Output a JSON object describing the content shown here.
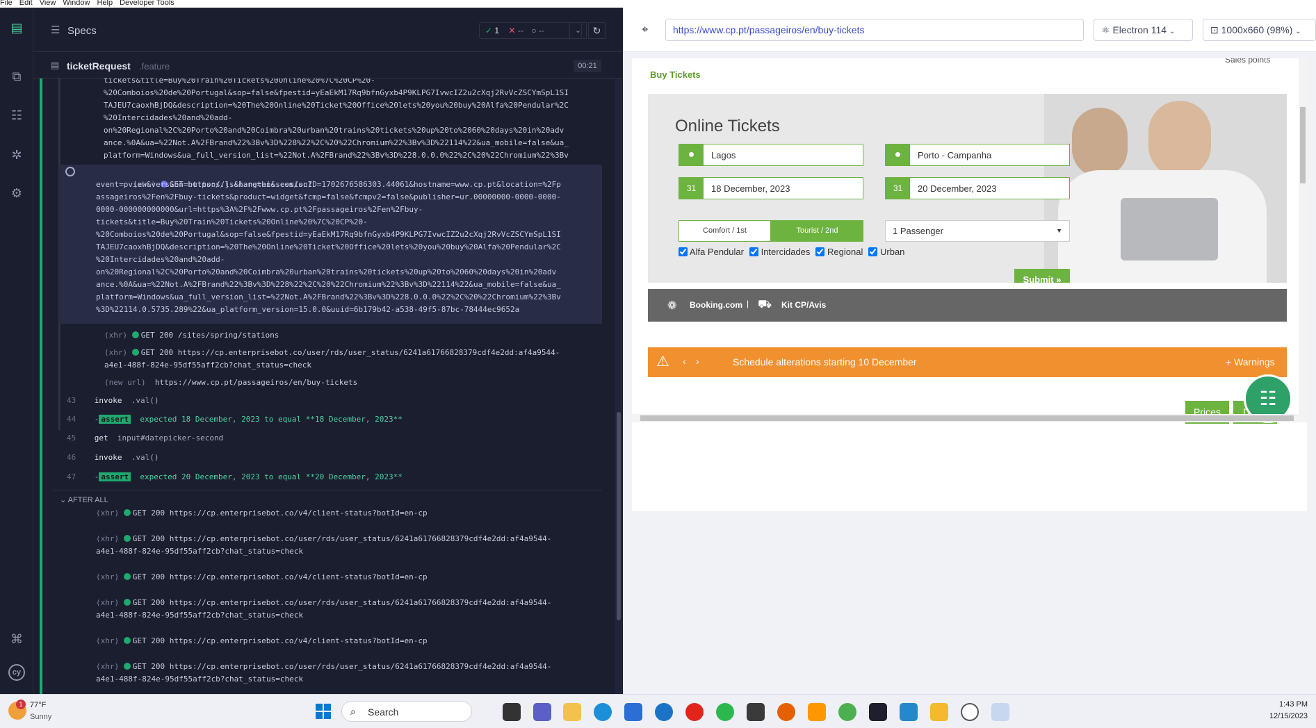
{
  "menubar": [
    "File",
    "Edit",
    "View",
    "Window",
    "Help",
    "Developer Tools"
  ],
  "reporter": {
    "specs_label": "Specs",
    "passed": "1",
    "failed": "--",
    "pending": "--",
    "spec_name": "ticketRequest",
    "spec_ext": ".feature",
    "duration": "00:21",
    "after_all": "AFTER ALL"
  },
  "log": {
    "block1": [
      "tickets&title=Buy%20Train%20Tickets%20Online%20%7C%20CP%20-",
      "%20Comboios%20de%20Portugal&sop=false&fpestid=yEaEkM17Rq9bfnGyxb4P9KLPG7IvwcIZ2u2cXqj2RvVcZSCYmSpL1SI",
      "TAJEU7caoxhBjDQ&description=%20The%20Online%20Ticket%20Office%20lets%20you%20buy%20Alfa%20Pendular%2C",
      "%20Intercidades%20and%20add-",
      "on%20Regional%2C%20Porto%20and%20Coimbra%20urban%20trains%20tickets%20up%20to%2060%20days%20in%20adv",
      "ance.%0A&ua=%22Not.A%2FBrand%22%3Bv%3D%228%22%2C%20%22Chromium%22%3Bv%3D%22114%22&ua_mobile=false&ua_",
      "platform=Windows&ua_full_version_list=%22Not.A%2FBrand%22%3Bv%3D%228.0.0.0%22%2C%20%22Chromium%22%3Bv",
      "%3D%22114.0.5735.289%22&ua_platform_version=15.0.0&uuid=6b179b42-a538-49f5-87bc-78444ec9652a"
    ],
    "xhr_label": "(xhr)",
    "block2_first": "GET https://l.sharethis.com/sc?",
    "block2": [
      "event=pview&version=buttons.js&lang=en&sessionID=1702676586303.44061&hostname=www.cp.pt&location=%2Fp",
      "assageiros%2Fen%2Fbuy-tickets&product=widget&fcmp=false&fcmpv2=false&publisher=ur.00000000-0000-0000-",
      "0000-000000000000&url=https%3A%2F%2Fwww.cp.pt%2Fpassageiros%2Fen%2Fbuy-",
      "tickets&title=Buy%20Train%20Tickets%20Online%20%7C%20CP%20-",
      "%20Comboios%20de%20Portugal&sop=false&fpestid=yEaEkM17Rq9bfnGyxb4P9KLPG7IvwcIZ2u2cXqj2RvVcZSCYmSpL1SI",
      "TAJEU7caoxhBjDQ&description=%20The%20Online%20Ticket%20Office%20lets%20you%20buy%20Alfa%20Pendular%2C",
      "%20Intercidades%20and%20add-",
      "on%20Regional%2C%20Porto%20and%20Coimbra%20urban%20trains%20tickets%20up%20to%2060%20days%20in%20adv",
      "ance.%0A&ua=%22Not.A%2FBrand%22%3Bv%3D%228%22%2C%20%22Chromium%22%3Bv%3D%22114%22&ua_mobile=false&ua_",
      "platform=Windows&ua_full_version_list=%22Not.A%2FBrand%22%3Bv%3D%228.0.0.0%22%2C%20%22Chromium%22%3Bv",
      "%3D%22114.0.5735.289%22&ua_platform_version=15.0.0&uuid=6b179b42-a538-49f5-87bc-78444ec9652a"
    ],
    "xhr_stations": "GET 200 /sites/spring/stations",
    "xhr_userstatus_1": "GET 200 https://cp.enterprisebot.co/user/rds/user_status/6241a61766828379cdf4e2dd:af4a9544-",
    "xhr_userstatus_2": "a4e1-488f-824e-95df55aff2cb?chat_status=check",
    "new_url_label": "(new url)",
    "new_url": "https://www.cp.pt/passageiros/en/buy-tickets",
    "cmd43_num": "43",
    "cmd43": "invoke",
    "cmd43_arg": ".val()",
    "cmd44_num": "44",
    "cmd44_badge": "assert",
    "cmd44_text": "expected 18 December, 2023 to equal **18 December, 2023**",
    "cmd45_num": "45",
    "cmd45": "get",
    "cmd45_arg": "input#datepicker-second",
    "cmd46_num": "46",
    "cmd46": "invoke",
    "cmd46_arg": ".val()",
    "cmd47_num": "47",
    "cmd47_badge": "assert",
    "cmd47_text": "expected 20 December, 2023 to equal **20 December, 2023**",
    "after": [
      {
        "a": "(xhr)",
        "b": "GET 200 https://cp.enterprisebot.co/v4/client-status?botId=en-cp",
        "c": ""
      },
      {
        "a": "(xhr)",
        "b": "GET 200 https://cp.enterprisebot.co/user/rds/user_status/6241a61766828379cdf4e2dd:af4a9544-",
        "c": "a4e1-488f-824e-95df55aff2cb?chat_status=check"
      },
      {
        "a": "(xhr)",
        "b": "GET 200 https://cp.enterprisebot.co/v4/client-status?botId=en-cp",
        "c": ""
      },
      {
        "a": "(xhr)",
        "b": "GET 200 https://cp.enterprisebot.co/user/rds/user_status/6241a61766828379cdf4e2dd:af4a9544-",
        "c": "a4e1-488f-824e-95df55aff2cb?chat_status=check"
      },
      {
        "a": "(xhr)",
        "b": "GET 200 https://cp.enterprisebot.co/v4/client-status?botId=en-cp",
        "c": ""
      },
      {
        "a": "(xhr)",
        "b": "GET 200 https://cp.enterprisebot.co/user/rds/user_status/6241a61766828379cdf4e2dd:af4a9544-",
        "c": "a4e1-488f-824e-95df55aff2cb?chat_status=check"
      }
    ]
  },
  "browser": {
    "url": "https://www.cp.pt/passageiros/en/buy-tickets",
    "browser_name": "Electron 114",
    "viewport_size": "1000x660 (98%)"
  },
  "page": {
    "top_cut": "Sales points",
    "buy_tickets": "Buy Tickets",
    "online_tickets": "Online Tickets",
    "from": "Lagos",
    "to": "Porto - Campanha",
    "date_depart": "18 December, 2023",
    "date_return": "20 December, 2023",
    "class_first": "Comfort / 1st",
    "class_second": "Tourist / 2nd",
    "passengers": "1 Passenger",
    "train_types": [
      "Alfa Pendular",
      "Intercidades",
      "Regional",
      "Urban"
    ],
    "submit": "Submit »",
    "booking": "Booking.com",
    "kit": "Kit CP/Avis",
    "alert": "Schedule alterations starting 10 December",
    "warnings": "+ Warnings",
    "prices": "Prices",
    "di": "Di"
  },
  "taskbar": {
    "weather_temp": "77°F",
    "weather_desc": "Sunny",
    "badge": "1",
    "search": "Search",
    "time": "1:43 PM",
    "date": "12/15/2023"
  },
  "colors": {
    "cp_green": "#6db33f",
    "alert_orange": "#f0902f",
    "reporter_bg": "#1b1e2e"
  }
}
